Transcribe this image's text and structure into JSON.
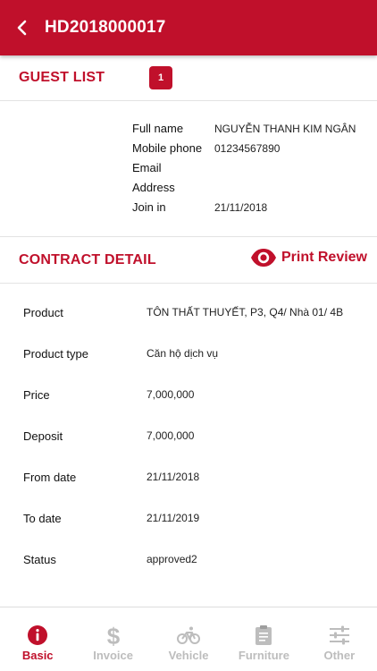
{
  "colors": {
    "accent": "#c0102b",
    "inactive": "#bdbdbd"
  },
  "header": {
    "title": "HD2018000017",
    "back_icon": "chevron-left-icon"
  },
  "guest_list": {
    "title": "GUEST LIST",
    "count": "1",
    "fields": [
      {
        "label": "Full name",
        "value": "NGUYỄN THANH KIM NGÂN"
      },
      {
        "label": "Mobile phone",
        "value": "01234567890"
      },
      {
        "label": "Email",
        "value": ""
      },
      {
        "label": "Address",
        "value": ""
      },
      {
        "label": "Join in",
        "value": "21/11/2018"
      }
    ]
  },
  "contract_detail": {
    "title": "CONTRACT DETAIL",
    "print_review_label": "Print Review",
    "print_review_icon": "eye-icon",
    "fields": [
      {
        "label": "Product",
        "value": "TÔN THẤT THUYẾT, P3, Q4/ Nhà 01/ 4B"
      },
      {
        "label": "Product type",
        "value": "Căn hộ dịch vụ"
      },
      {
        "label": "Price",
        "value": "7,000,000"
      },
      {
        "label": "Deposit",
        "value": "7,000,000"
      },
      {
        "label": "From date",
        "value": "21/11/2018"
      },
      {
        "label": "To date",
        "value": "21/11/2019"
      },
      {
        "label": "Status",
        "value": "approved2"
      }
    ]
  },
  "tabs": [
    {
      "label": "Basic",
      "icon": "info-icon",
      "active": true
    },
    {
      "label": "Invoice",
      "icon": "dollar-icon",
      "active": false
    },
    {
      "label": "Vehicle",
      "icon": "bicycle-icon",
      "active": false
    },
    {
      "label": "Furniture",
      "icon": "clipboard-icon",
      "active": false
    },
    {
      "label": "Other",
      "icon": "sliders-icon",
      "active": false
    }
  ]
}
